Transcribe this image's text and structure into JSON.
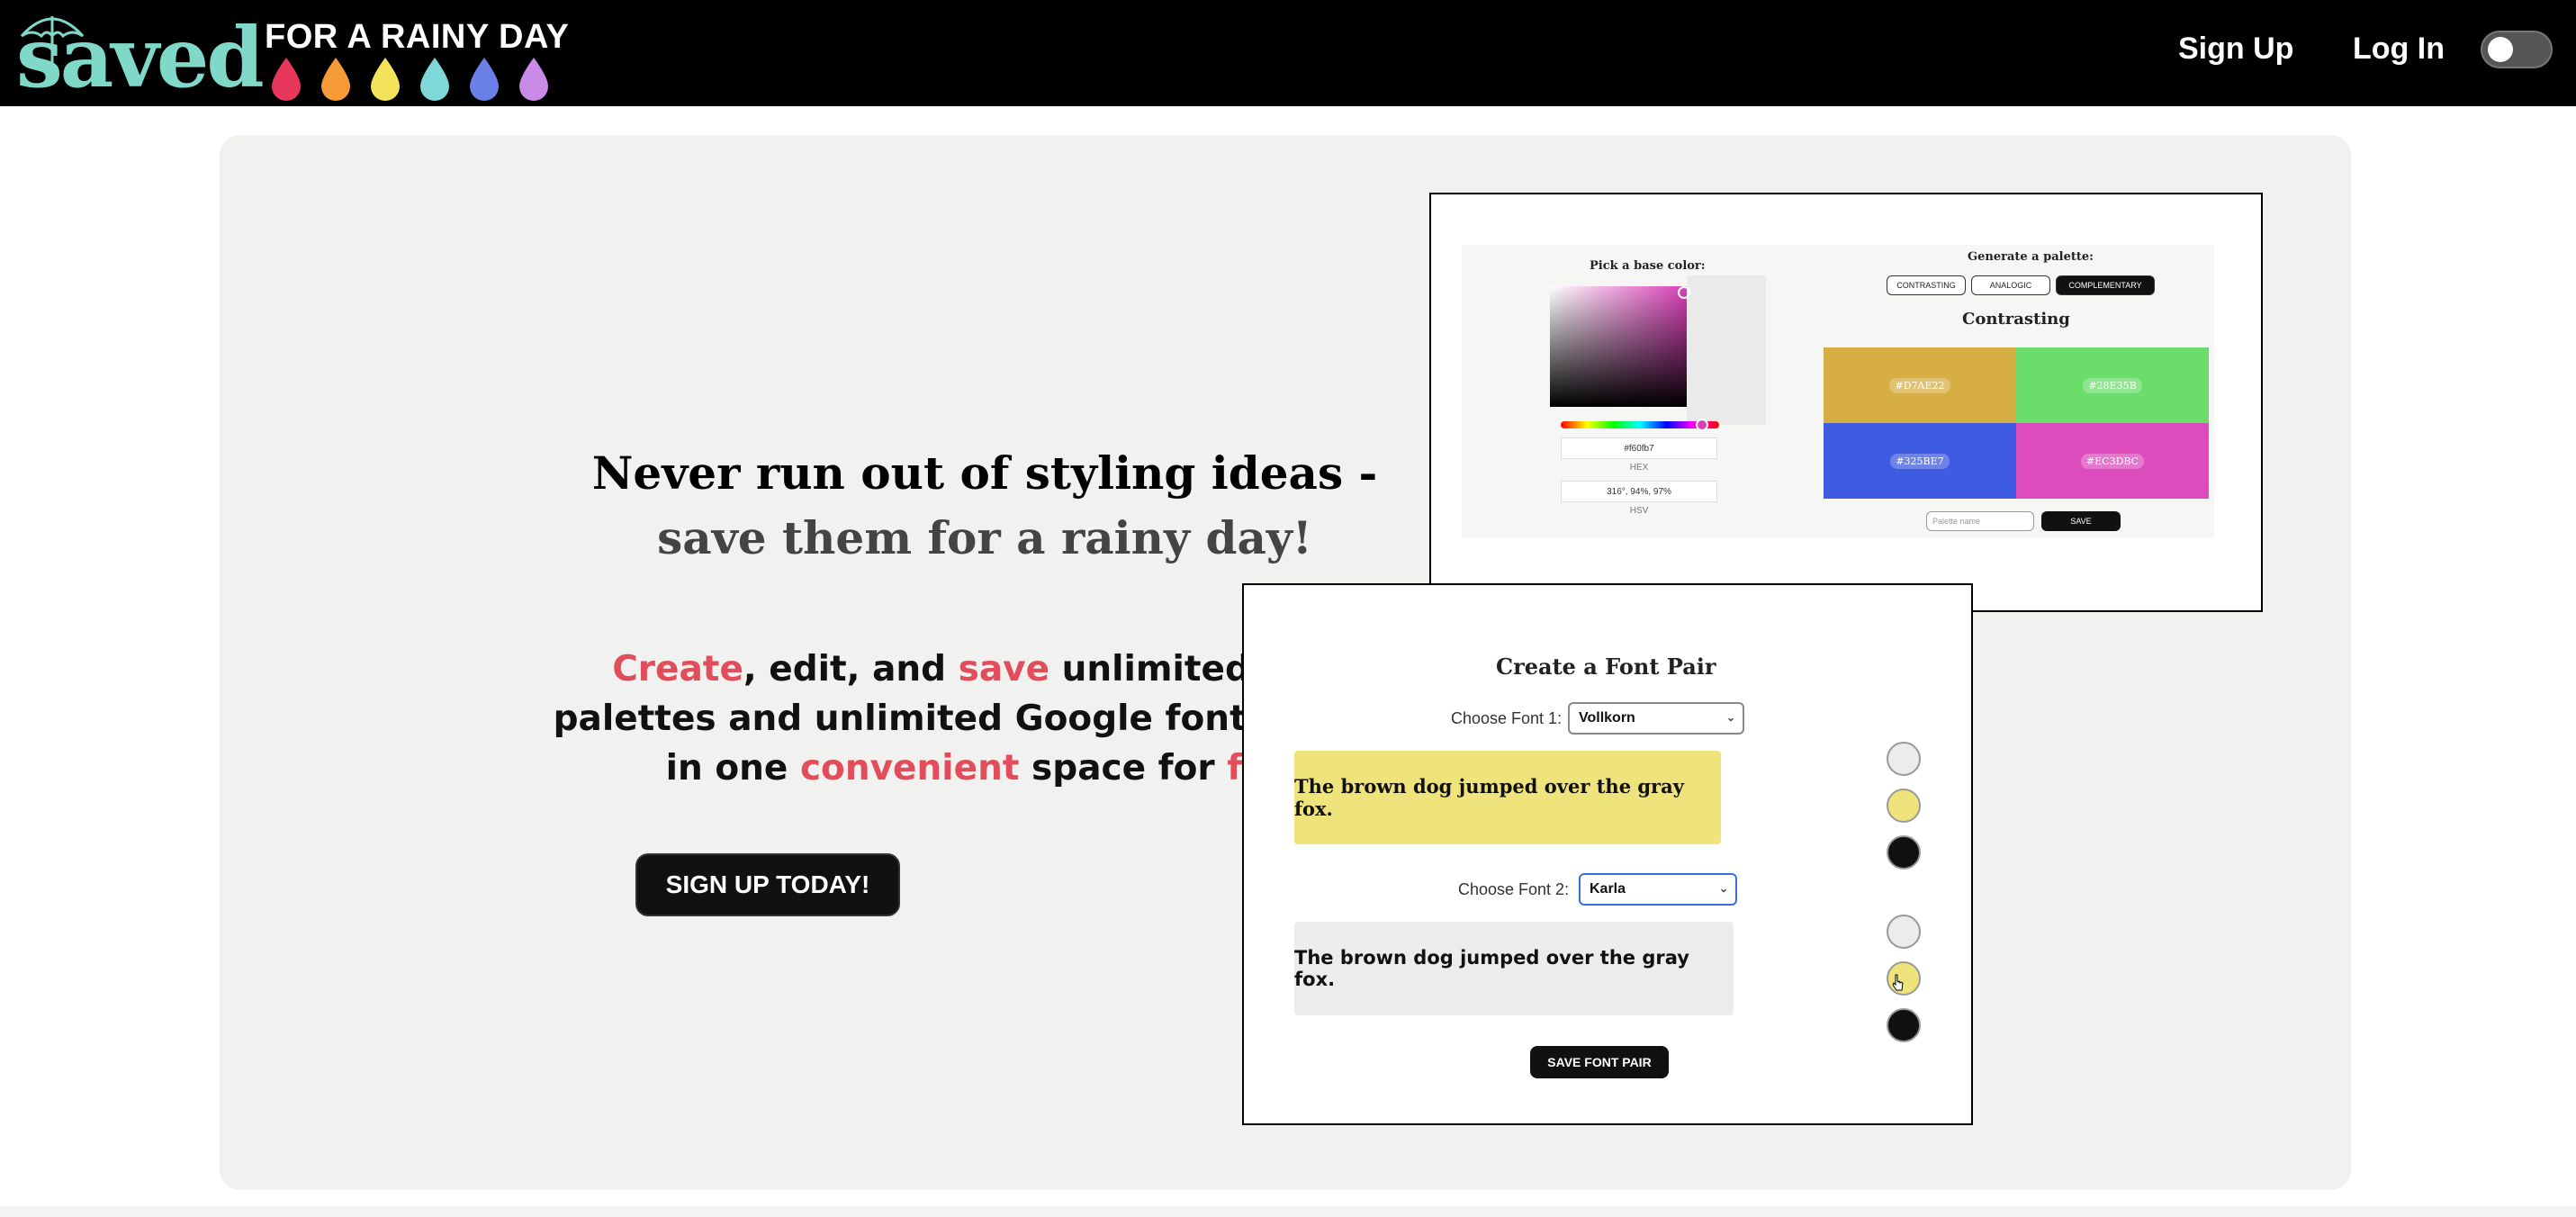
{
  "nav": {
    "logo_word": "saved",
    "logo_tag": "FOR A RAINY DAY",
    "signup": "Sign Up",
    "login": "Log In",
    "theme_toggle": "off"
  },
  "hero": {
    "title_line1": "Never run out of styling ideas -",
    "title_line2": "save them for a rainy day!",
    "sub": {
      "w1": "Create",
      "w2": ", edit, and ",
      "w3": "save",
      "w4": " unlimited color",
      "line2": "palettes and unlimited Google font pairings",
      "w5": "in one ",
      "w6": "convenient",
      "w7": " space for ",
      "w8": "free"
    },
    "cta": "SIGN UP TODAY!"
  },
  "palette_shot": {
    "pick_label": "Pick a base color:",
    "hex_value": "#f60fb7",
    "hex_caption": "HEX",
    "hsv_value": "316°, 94%, 97%",
    "hsv_caption": "HSV",
    "generate_label": "Generate a palette:",
    "tabs": [
      "CONTRASTING",
      "ANALOGIC",
      "COMPLEMENTARY"
    ],
    "active_tab": "COMPLEMENTARY",
    "heading": "Contrasting",
    "swatches": [
      {
        "hex": "#D7AE22",
        "color": "#d7ae43"
      },
      {
        "hex": "#28E35B",
        "color": "#6add6b"
      },
      {
        "hex": "#325BE7",
        "color": "#3f5be2"
      },
      {
        "hex": "#EC3DBC",
        "color": "#dc4cbc"
      }
    ],
    "name_placeholder": "Palette name",
    "save": "SAVE"
  },
  "font_shot": {
    "title": "Create a Font Pair",
    "font1_label": "Choose Font 1:",
    "font1_value": "Vollkorn",
    "font2_label": "Choose Font 2:",
    "font2_value": "Karla",
    "sample_text": "The brown dog jumped over the gray fox.",
    "colors1": [
      "#ececec",
      "#efe47c",
      "#111111"
    ],
    "colors2": [
      "#ececec",
      "#efe47c",
      "#111111"
    ],
    "save": "SAVE FONT PAIR"
  },
  "drop_colors": [
    "#e8365d",
    "#f59a36",
    "#f2e35a",
    "#7fd8d8",
    "#6b7fe8",
    "#c98ae8"
  ]
}
